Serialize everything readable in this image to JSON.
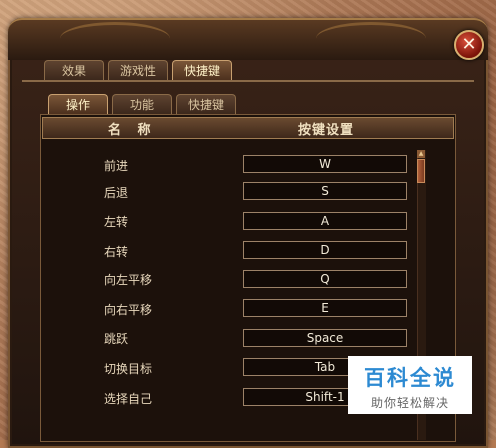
{
  "tabs_top": [
    {
      "label": "效果",
      "active": false
    },
    {
      "label": "游戏性",
      "active": false
    },
    {
      "label": "快捷键",
      "active": true
    }
  ],
  "tabs_sub": [
    {
      "label": "操作",
      "active": true
    },
    {
      "label": "功能",
      "active": false
    },
    {
      "label": "快捷键",
      "active": false
    }
  ],
  "table": {
    "header_name": "名 称",
    "header_key": "按键设置",
    "rows": [
      {
        "name": "前进",
        "key": "W"
      },
      {
        "name": "后退",
        "key": "S"
      },
      {
        "name": "左转",
        "key": "A"
      },
      {
        "name": "右转",
        "key": "D"
      },
      {
        "name": "向左平移",
        "key": "Q"
      },
      {
        "name": "向右平移",
        "key": "E"
      },
      {
        "name": "跳跃",
        "key": "Space"
      },
      {
        "name": "切换目标",
        "key": "Tab"
      },
      {
        "name": "选择自己",
        "key": "Shift-1"
      }
    ]
  },
  "close_icon_glyph": "✕",
  "scroll_up_glyph": "▲",
  "watermark": {
    "main": "百科全说",
    "sub": "助你轻松解决"
  }
}
